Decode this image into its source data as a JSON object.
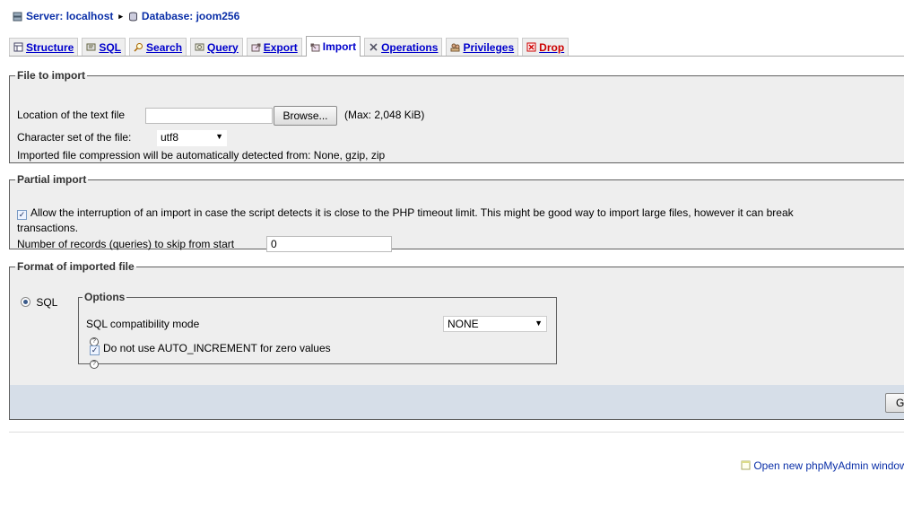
{
  "breadcrumb": {
    "server": "Server: localhost",
    "separator": "▸",
    "database": "Database: joom256"
  },
  "tabs": [
    {
      "label": "Structure",
      "icon": "structure-icon"
    },
    {
      "label": "SQL",
      "icon": "sql-icon"
    },
    {
      "label": "Search",
      "icon": "search-icon"
    },
    {
      "label": "Query",
      "icon": "query-icon"
    },
    {
      "label": "Export",
      "icon": "export-icon"
    },
    {
      "label": "Import",
      "icon": "import-icon",
      "active": true
    },
    {
      "label": "Operations",
      "icon": "operations-icon"
    },
    {
      "label": "Privileges",
      "icon": "privileges-icon"
    },
    {
      "label": "Drop",
      "icon": "drop-icon"
    }
  ],
  "file_import": {
    "legend": "File to import",
    "location_label": "Location of the text file",
    "file_value": "",
    "browse_label": "Browse...",
    "max_size": "(Max: 2,048 KiB)",
    "charset_label": "Character set of the file:",
    "charset_value": "utf8",
    "compression_note": "Imported file compression will be automatically detected from: None, gzip, zip"
  },
  "partial_import": {
    "legend": "Partial import",
    "allow_interrupt_checked": true,
    "allow_interrupt_line1": "Allow the interruption of an import in case the script detects it is close to the PHP timeout limit. This might be good way to import large files, however it can break",
    "allow_interrupt_line2": "transactions.",
    "skip_label": "Number of records (queries) to skip from start",
    "skip_value": "0"
  },
  "format": {
    "legend": "Format of imported file",
    "sql_label": "SQL",
    "sql_selected": true,
    "options": {
      "legend": "Options",
      "compat_label": "SQL compatibility mode",
      "compat_value": "NONE",
      "no_auto_increment_checked": true,
      "no_auto_increment_label": "Do not use AUTO_INCREMENT for zero values",
      "help_glyph": "?"
    }
  },
  "go_label": "Go",
  "open_new_window": "Open new phpMyAdmin window",
  "colors": {
    "link": "#0a2fa8",
    "panel_bg": "#eeeeee",
    "go_bar_bg": "#d6dee8",
    "drop_red": "#cc0000"
  }
}
